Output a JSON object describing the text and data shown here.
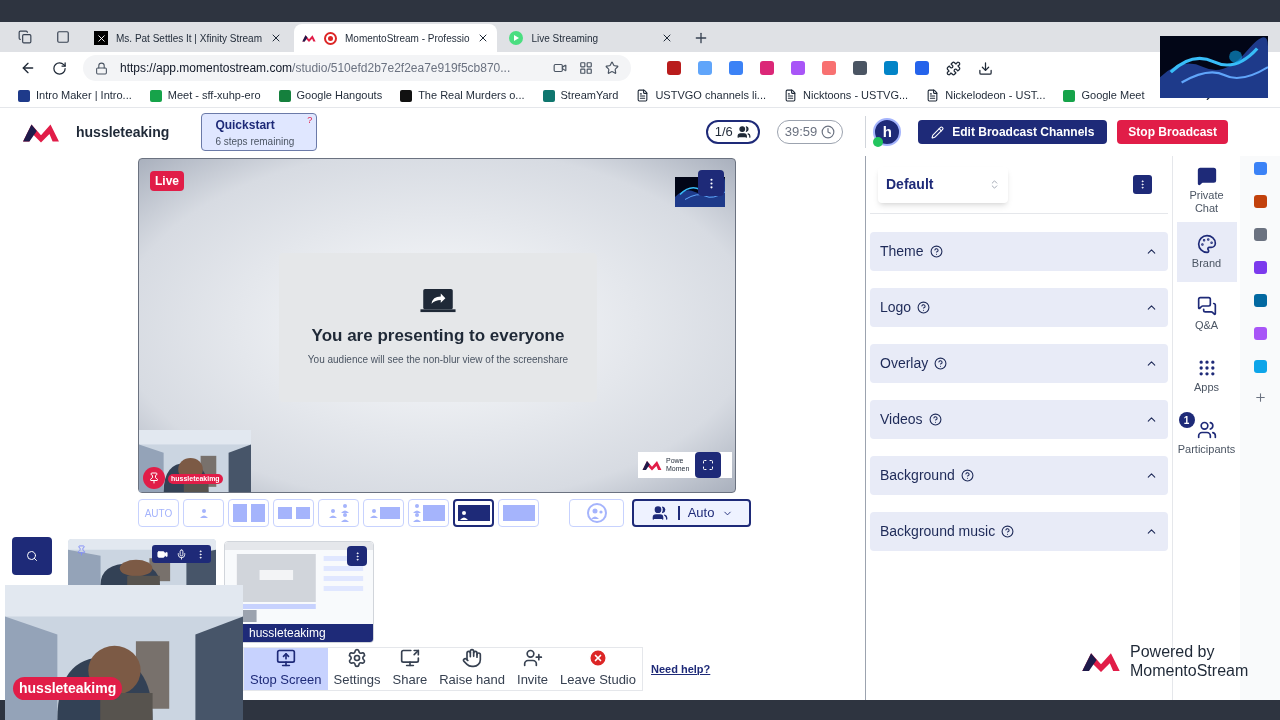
{
  "browser": {
    "tabs": [
      {
        "title": "Ms. Pat Settles It | Xfinity Stream",
        "selected": false,
        "kind": "x"
      },
      {
        "title": "MomentoStream - Professio",
        "selected": true,
        "kind": "momento"
      },
      {
        "title": "Live Streaming",
        "selected": false,
        "kind": "play"
      }
    ],
    "url": {
      "host": "https://app.momentostream.com",
      "path": "/studio/510efd2b7e2f2ea7e919f5cb870..."
    },
    "bookmarks": [
      {
        "label": "Intro Maker | Intro...",
        "kind": "site",
        "color": "#1e3a8a"
      },
      {
        "label": "Meet - sff-xuhp-ero",
        "kind": "site",
        "color": "#16a34a"
      },
      {
        "label": "Google Hangouts",
        "kind": "site",
        "color": "#15803d"
      },
      {
        "label": "The Real Murders o...",
        "kind": "site",
        "color": "#111111"
      },
      {
        "label": "StreamYard",
        "kind": "site",
        "color": "#0f766e"
      },
      {
        "label": "USTVGO channels li...",
        "kind": "page"
      },
      {
        "label": "Nicktoons - USTVG...",
        "kind": "page"
      },
      {
        "label": "Nickelodeon - UST...",
        "kind": "page"
      },
      {
        "label": "Google Meet",
        "kind": "site",
        "color": "#16a34a"
      }
    ]
  },
  "header": {
    "brand": "hussleteaking",
    "quickstart": {
      "title": "Quickstart",
      "subtitle": "6 steps remaining",
      "mark": "?"
    },
    "participants": "1/6",
    "timer": "39:59",
    "avatar": "h",
    "edit_button": "Edit Broadcast Channels",
    "stop_button": "Stop Broadcast"
  },
  "stage": {
    "live": "Live",
    "title": "You are presenting to everyone",
    "subtitle": "You audience will see the non-blur view of the screenshare",
    "guest_name": "hussleteakimg",
    "watermark": [
      "Powe",
      "Momen"
    ]
  },
  "layouts": [
    {
      "kind": "auto",
      "label": "AUTO",
      "selected": false
    },
    {
      "kind": "solo",
      "selected": false
    },
    {
      "kind": "duo",
      "selected": false
    },
    {
      "kind": "duo-box",
      "selected": false
    },
    {
      "kind": "side-dots",
      "selected": false
    },
    {
      "kind": "person-screen",
      "selected": false
    },
    {
      "kind": "dots-screen",
      "selected": false
    },
    {
      "kind": "screen-person",
      "selected": true
    },
    {
      "kind": "screen",
      "selected": false
    }
  ],
  "auto_mode": "Auto",
  "screen_share_label": "hussleteakimg",
  "controls": [
    {
      "kind": "stop-screen",
      "label": "Stop Screen",
      "active": true
    },
    {
      "kind": "settings",
      "label": "Settings",
      "active": false
    },
    {
      "kind": "share",
      "label": "Share",
      "active": false
    },
    {
      "kind": "raise-hand",
      "label": "Raise hand",
      "active": false
    },
    {
      "kind": "invite",
      "label": "Invite",
      "active": false
    },
    {
      "kind": "leave",
      "label": "Leave Studio",
      "active": false
    }
  ],
  "help_link": "Need help?",
  "self_view_name": "hussleteakimg",
  "brand_panel": {
    "preset": "Default",
    "sections": [
      {
        "label": "Theme",
        "expanded": false
      },
      {
        "label": "Logo",
        "expanded": false
      },
      {
        "label": "Overlay",
        "expanded": false
      },
      {
        "label": "Videos",
        "expanded": false
      },
      {
        "label": "Background",
        "expanded": false
      },
      {
        "label": "Background music",
        "expanded": false
      }
    ]
  },
  "sidebar": [
    {
      "kind": "chat",
      "label": "Private Chat",
      "selected": false
    },
    {
      "kind": "brand",
      "label": "Brand",
      "selected": true
    },
    {
      "kind": "qa",
      "label": "Q&A",
      "selected": false
    },
    {
      "kind": "apps",
      "label": "Apps",
      "selected": false
    },
    {
      "kind": "participants",
      "label": "Participants",
      "selected": false,
      "badge": "1"
    }
  ],
  "powered": {
    "line1": "Powered by",
    "line2": "MomentoStream"
  }
}
